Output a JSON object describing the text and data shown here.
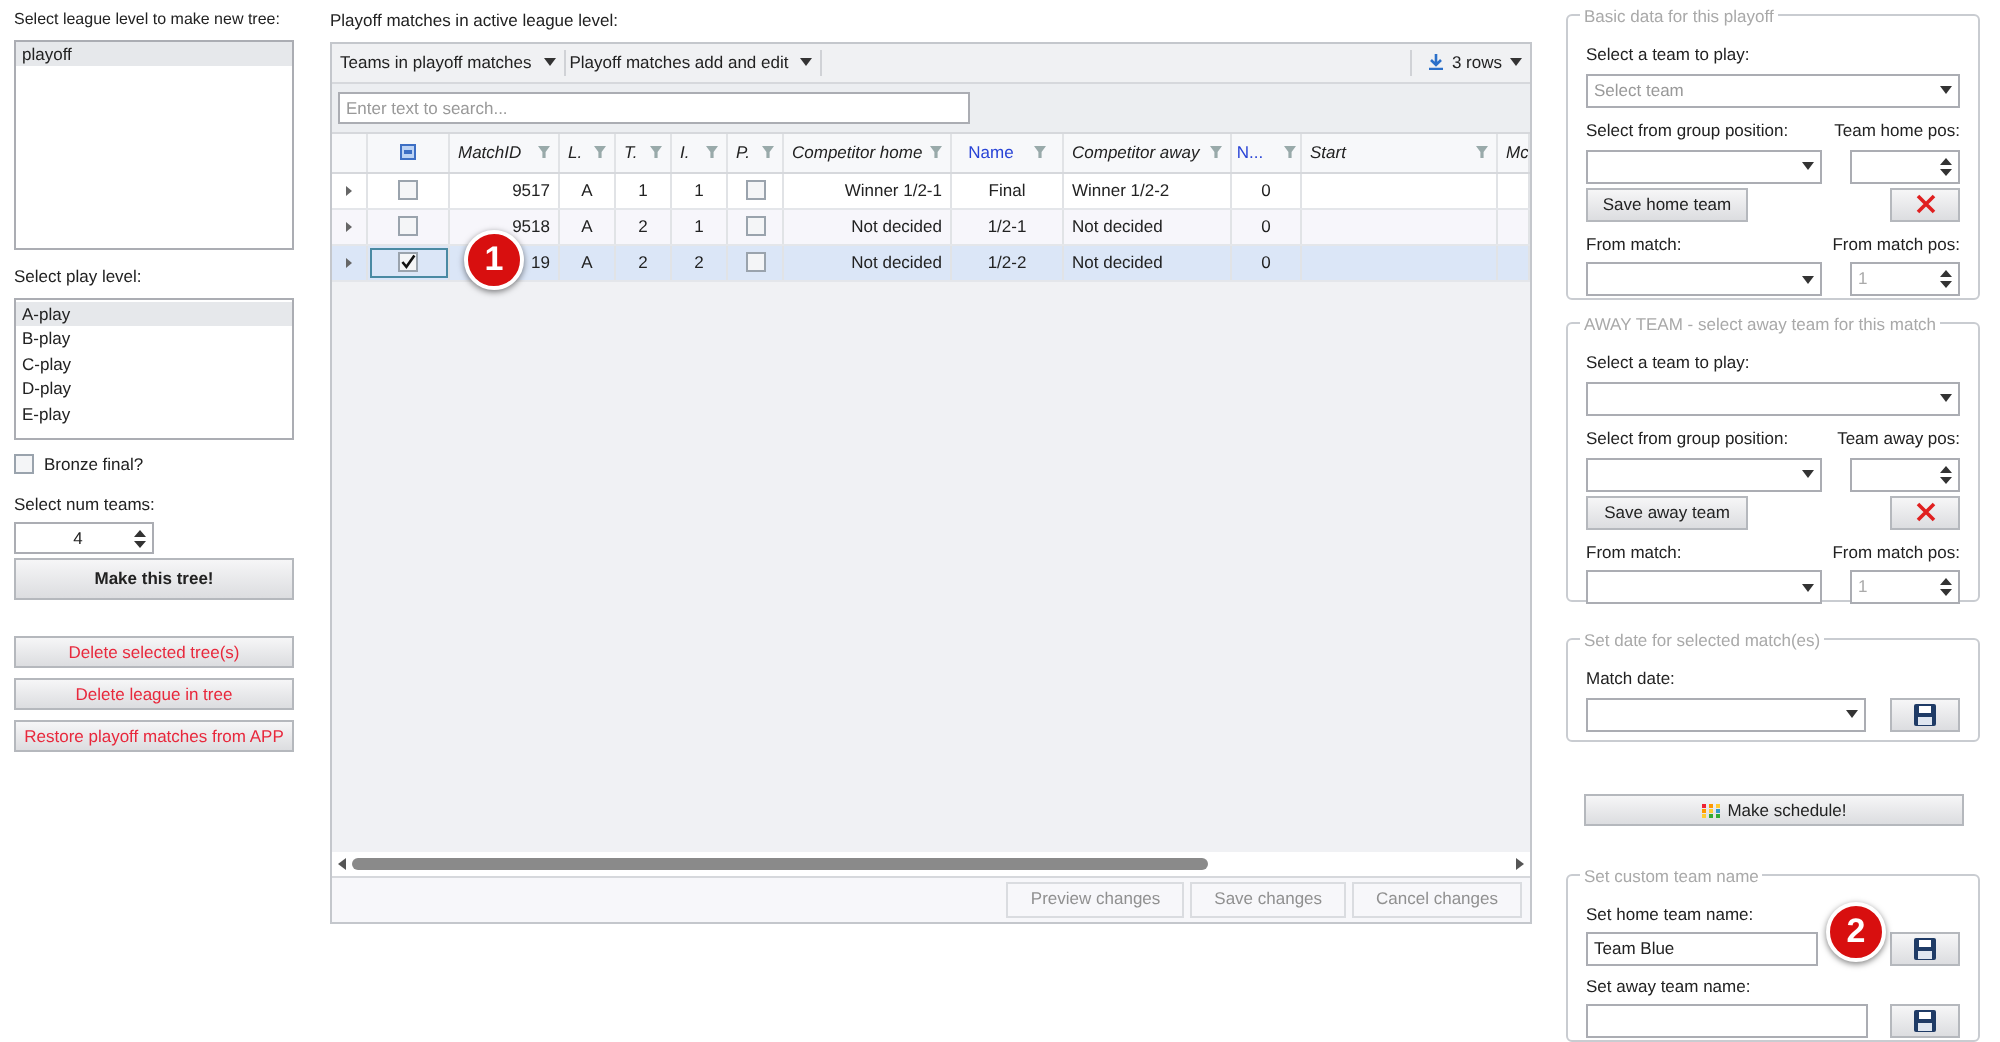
{
  "left": {
    "league_label": "Select league level to make new tree:",
    "league_items": [
      {
        "label": "playoff",
        "selected": true
      }
    ],
    "play_label": "Select play level:",
    "play_items": [
      {
        "label": "A-play",
        "selected": true
      },
      {
        "label": "B-play",
        "selected": false
      },
      {
        "label": "C-play",
        "selected": false
      },
      {
        "label": "D-play",
        "selected": false
      },
      {
        "label": "E-play",
        "selected": false
      }
    ],
    "bronze": {
      "label": "Bronze final?",
      "checked": false
    },
    "num_label": "Select num teams:",
    "num_value": "4",
    "make_button": "Make this tree!",
    "actions": [
      "Delete selected tree(s)",
      "Delete league in tree",
      "Restore playoff matches from APP"
    ]
  },
  "grid": {
    "title": "Playoff matches in active league level:",
    "toolbar": [
      "Teams in playoff matches",
      "Playoff matches add and edit"
    ],
    "export": "3 rows",
    "select_all_partial": true,
    "search_placeholder": "Enter text to search...",
    "columns": [
      {
        "label": "MatchID",
        "highlighted": false
      },
      {
        "label": "L.",
        "highlighted": false
      },
      {
        "label": "T.",
        "highlighted": false
      },
      {
        "label": "I.",
        "highlighted": false
      },
      {
        "label": "P.",
        "highlighted": false
      },
      {
        "label": "Competitor home",
        "highlighted": false
      },
      {
        "label": "Name",
        "highlighted": true
      },
      {
        "label": "Competitor away",
        "highlighted": false
      },
      {
        "label": "N...",
        "highlighted": true
      },
      {
        "label": "Start",
        "highlighted": false
      },
      {
        "label": "Mc",
        "highlighted": false
      }
    ],
    "rows": [
      {
        "selected": false,
        "checked": false,
        "match_id": "9517",
        "l": "A",
        "t": "1",
        "i": "1",
        "p_checked": false,
        "home": "Winner 1/2-1",
        "name": "Final",
        "away": "Winner 1/2-2",
        "n": "0"
      },
      {
        "selected": false,
        "checked": false,
        "match_id": "9518",
        "l": "A",
        "t": "2",
        "i": "1",
        "p_checked": false,
        "home": "Not decided",
        "name": "1/2-1",
        "away": "Not decided",
        "n": "0"
      },
      {
        "selected": true,
        "checked": true,
        "match_id": "19",
        "l": "A",
        "t": "2",
        "i": "2",
        "p_checked": false,
        "home": "Not decided",
        "name": "1/2-2",
        "away": "Not decided",
        "n": "0"
      }
    ],
    "buttons": [
      "Preview changes",
      "Save changes",
      "Cancel changes"
    ]
  },
  "right": {
    "home": {
      "legend": "Basic data for this playoff",
      "team_label": "Select a team to play:",
      "team_placeholder": "Select team",
      "group_pos_label": "Select from group position:",
      "pos_label": "Team home pos:",
      "save_button": "Save home team",
      "from_match_label": "From match:",
      "from_match_pos_label": "From match pos:",
      "from_match_pos_value": "1"
    },
    "away": {
      "legend": "AWAY TEAM - select away team for this match",
      "team_label": "Select a team to play:",
      "group_pos_label": "Select from group position:",
      "pos_label": "Team away pos:",
      "save_button": "Save away team",
      "from_match_label": "From match:",
      "from_match_pos_label": "From match pos:",
      "from_match_pos_value": "1"
    },
    "date": {
      "legend": "Set date for selected match(es)",
      "label": "Match date:"
    },
    "schedule_button": "Make schedule!",
    "custom": {
      "legend": "Set custom team name",
      "home_label": "Set home team name:",
      "home_value": "Team Blue",
      "away_label": "Set away team name:"
    }
  },
  "callouts": [
    "1",
    "2"
  ]
}
